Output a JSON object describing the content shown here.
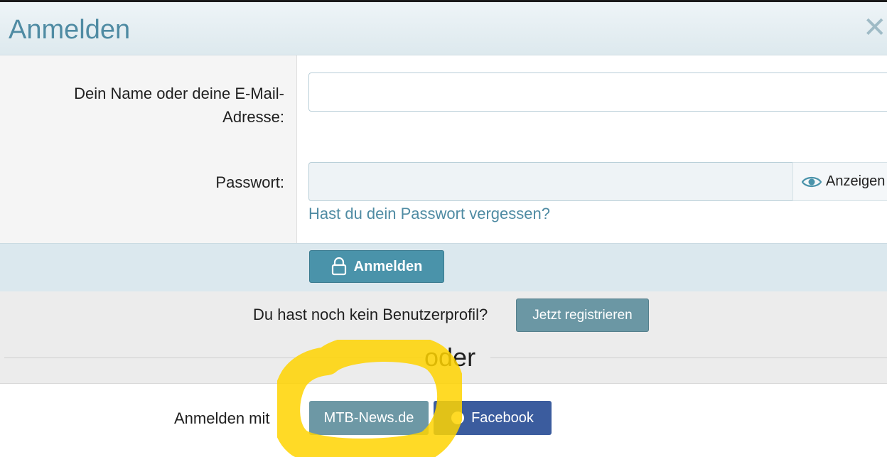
{
  "dialog": {
    "title": "Anmelden",
    "close_symbol": "✕"
  },
  "form": {
    "name_label": "Dein Name oder deine E-Mail-Adresse:",
    "name_value": "",
    "password_label": "Passwort:",
    "password_value": "",
    "show_label": "Anzeigen",
    "forgot_link": "Hast du dein Passwort vergessen?",
    "submit_label": "Anmelden"
  },
  "register": {
    "prompt": "Du hast noch kein Benutzerprofil?",
    "button_label": "Jetzt registrieren"
  },
  "separator": {
    "text": "oder"
  },
  "providers": {
    "label": "Anmelden mit",
    "items": [
      {
        "label": "MTB-News.de"
      },
      {
        "label": "Facebook"
      }
    ]
  },
  "icons": {
    "close": "close-icon",
    "eye": "eye-icon",
    "lock": "lock-icon",
    "facebook": "facebook-icon"
  },
  "colors": {
    "accent": "#4a93aa",
    "link": "#4f8ba3",
    "facebook": "#3b5c9e",
    "register": "#6b97a4",
    "highlight": "#ffd400"
  }
}
